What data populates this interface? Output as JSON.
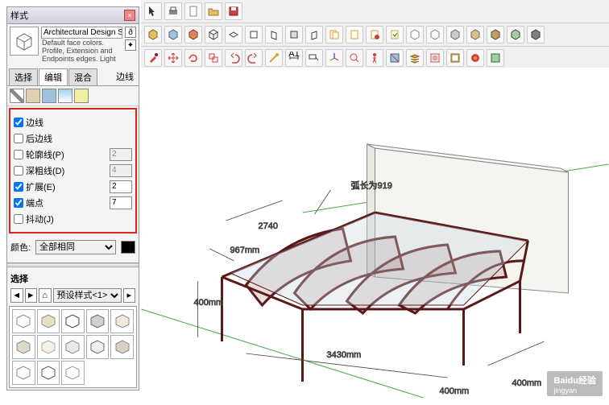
{
  "panel": {
    "title": "样式",
    "style_name": "Architectural Design Style",
    "style_desc": "Default face colors. Profile, Extension and Endpoints edges. Light"
  },
  "tabs": {
    "select": "选择",
    "edit": "编辑",
    "mix": "混合",
    "side": "边线"
  },
  "edges": {
    "edge": "边线",
    "back": "后边线",
    "profile": "轮廓线(P)",
    "depth": "深粗线(D)",
    "extension": "扩展(E)",
    "endpoint": "端点",
    "jitter": "抖动(J)",
    "val_profile": "2",
    "val_depth": "4",
    "val_extension": "2",
    "val_endpoint": "7"
  },
  "color": {
    "label": "颜色:",
    "option": "全部相同"
  },
  "lower": {
    "select": "选择",
    "preset": "预设样式<1>"
  },
  "annot": {
    "arc": "弧长为919",
    "d1": "2740",
    "d2": "967mm",
    "d3": "400mm",
    "d4": "3430mm",
    "d5": "400mm",
    "d6": "400mm"
  },
  "watermark": {
    "main": "Baidu经验",
    "sub": "jingyan"
  }
}
